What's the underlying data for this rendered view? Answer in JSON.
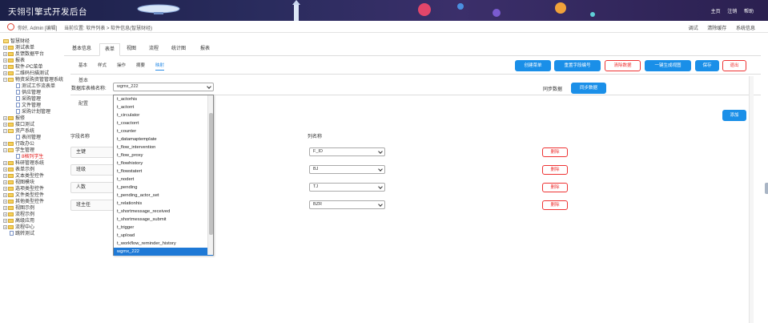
{
  "header": {
    "title": "天翎引擎式开发后台",
    "nav": [
      "主页",
      "注销",
      "帮助"
    ]
  },
  "subbar": {
    "greeting": "你好, Admin [编辑]",
    "location": "当前位置: 软件列表 > 软件信息(智慧财经)",
    "tools": [
      "调试",
      "清除缓存",
      "系统信息"
    ]
  },
  "sidebar": {
    "items": [
      {
        "label": "智慧财经",
        "kind": "root"
      },
      {
        "label": "测试表单",
        "kind": "folder"
      },
      {
        "label": "反馈数据平台",
        "kind": "folder"
      },
      {
        "label": "报表",
        "kind": "folder"
      },
      {
        "label": "软件-PC菜单",
        "kind": "folder"
      },
      {
        "label": "二维码扫描测试",
        "kind": "folder"
      },
      {
        "label": "物资采购资管管理系统",
        "kind": "folder-open"
      },
      {
        "label": "测试工作流表单",
        "kind": "page"
      },
      {
        "label": "供应管理",
        "kind": "page"
      },
      {
        "label": "采购管理",
        "kind": "page"
      },
      {
        "label": "文件管理",
        "kind": "page"
      },
      {
        "label": "采购计划管理",
        "kind": "page"
      },
      {
        "label": "报修",
        "kind": "folder"
      },
      {
        "label": "接口测试",
        "kind": "folder"
      },
      {
        "label": "资产系统",
        "kind": "folder-open"
      },
      {
        "label": "表间管理",
        "kind": "page"
      },
      {
        "label": "行政办公",
        "kind": "folder"
      },
      {
        "label": "学生管理",
        "kind": "folder-open"
      },
      {
        "label": "8格列学生",
        "kind": "page-selected"
      },
      {
        "label": "科研管理系统",
        "kind": "folder"
      },
      {
        "label": "表单示例",
        "kind": "folder"
      },
      {
        "label": "文本类型控件",
        "kind": "folder"
      },
      {
        "label": "视图模块",
        "kind": "folder"
      },
      {
        "label": "选项类型控件",
        "kind": "folder"
      },
      {
        "label": "文件类型控件",
        "kind": "folder"
      },
      {
        "label": "其他类型控件",
        "kind": "folder"
      },
      {
        "label": "视图示例",
        "kind": "folder"
      },
      {
        "label": "流程示例",
        "kind": "folder"
      },
      {
        "label": "高级应用",
        "kind": "folder"
      },
      {
        "label": "流程中心",
        "kind": "folder"
      },
      {
        "label": "跳转测试",
        "kind": "page"
      }
    ]
  },
  "tabs": [
    "基本信息",
    "表单",
    "视图",
    "流程",
    "统计图",
    "报表"
  ],
  "active_tab": "表单",
  "subtabs": [
    "基本",
    "样式",
    "操作",
    "摘要",
    "映射"
  ],
  "active_subtab": "映射",
  "actions": {
    "create_menu": "创建菜单",
    "reset_fields": "重置字段编号",
    "clear_data": "清除数据",
    "generate_view": "一键生成视图",
    "save": "保存",
    "exit": "退出"
  },
  "section_basic": "基本",
  "table_label": "数据库表格名称:",
  "table_selected": "wgmx_222",
  "sync_label": "同步数据",
  "sync_button": "同步数据",
  "section_config": "配置",
  "add_button": "添加",
  "field_col_header": "字段名称",
  "column_col_header": "列名称",
  "mappings": [
    {
      "field": "主键",
      "column": "F_ID",
      "delete": "删除"
    },
    {
      "field": "班级",
      "column": "BJ",
      "delete": "删除"
    },
    {
      "field": "人数",
      "column": "TJ",
      "delete": "删除"
    },
    {
      "field": "班主任",
      "column": "BZR",
      "delete": "删除"
    }
  ],
  "dropdown_options": [
    "t_actorhis",
    "t_actorrt",
    "t_circulator",
    "t_coactorrt",
    "t_counter",
    "t_datamaptemplate",
    "t_flow_intervention",
    "t_flow_proxy",
    "t_flowhistory",
    "t_flowstatert",
    "t_nodert",
    "t_pending",
    "t_pending_actor_set",
    "t_relationhis",
    "t_shortmessage_received",
    "t_shortmessage_submit",
    "t_trigger",
    "t_upload",
    "t_workflow_reminder_history",
    "wgmx_222"
  ],
  "colors": {
    "accent": "#1a8fe8",
    "danger": "#e33333",
    "header_bg": "#23265a"
  }
}
